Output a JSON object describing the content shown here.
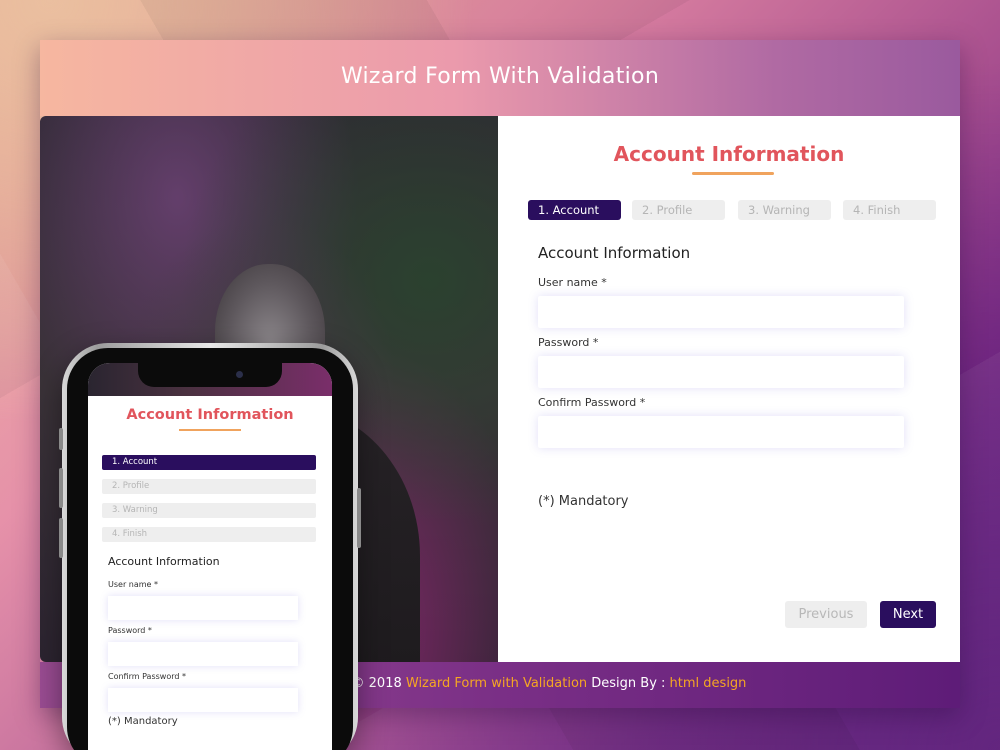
{
  "page": {
    "title": "Wizard Form With Validation"
  },
  "form": {
    "heading": "Account Information",
    "steps": [
      {
        "label": "1. Account",
        "active": true
      },
      {
        "label": "2. Profile",
        "active": false
      },
      {
        "label": "3. Warning",
        "active": false
      },
      {
        "label": "4. Finish",
        "active": false
      }
    ],
    "section_title": "Account Information",
    "fields": {
      "username_label": "User name *",
      "username_value": "",
      "password_label": "Password *",
      "password_value": "",
      "confirm_label": "Confirm Password *",
      "confirm_value": ""
    },
    "mandatory_note": "(*) Mandatory",
    "previous_label": "Previous",
    "next_label": "Next"
  },
  "phone": {
    "heading": "Account Information",
    "steps": [
      "1. Account",
      "2. Profile",
      "3. Warning",
      "4. Finish"
    ],
    "section_title": "Account Information",
    "username_label": "User name *",
    "password_label": "Password *",
    "confirm_label": "Confirm Password *",
    "mandatory_note": "(*) Mandatory"
  },
  "footer": {
    "prefix": "d. © 2018 ",
    "highlight_1": "Wizard Form with Validation",
    "middle": " Design By : ",
    "highlight_2": "html design"
  },
  "colors": {
    "accent_title": "#e1555c",
    "underline": "#f0a35d",
    "primary": "#2a0e5e",
    "footer_highlight": "#f5a623"
  }
}
